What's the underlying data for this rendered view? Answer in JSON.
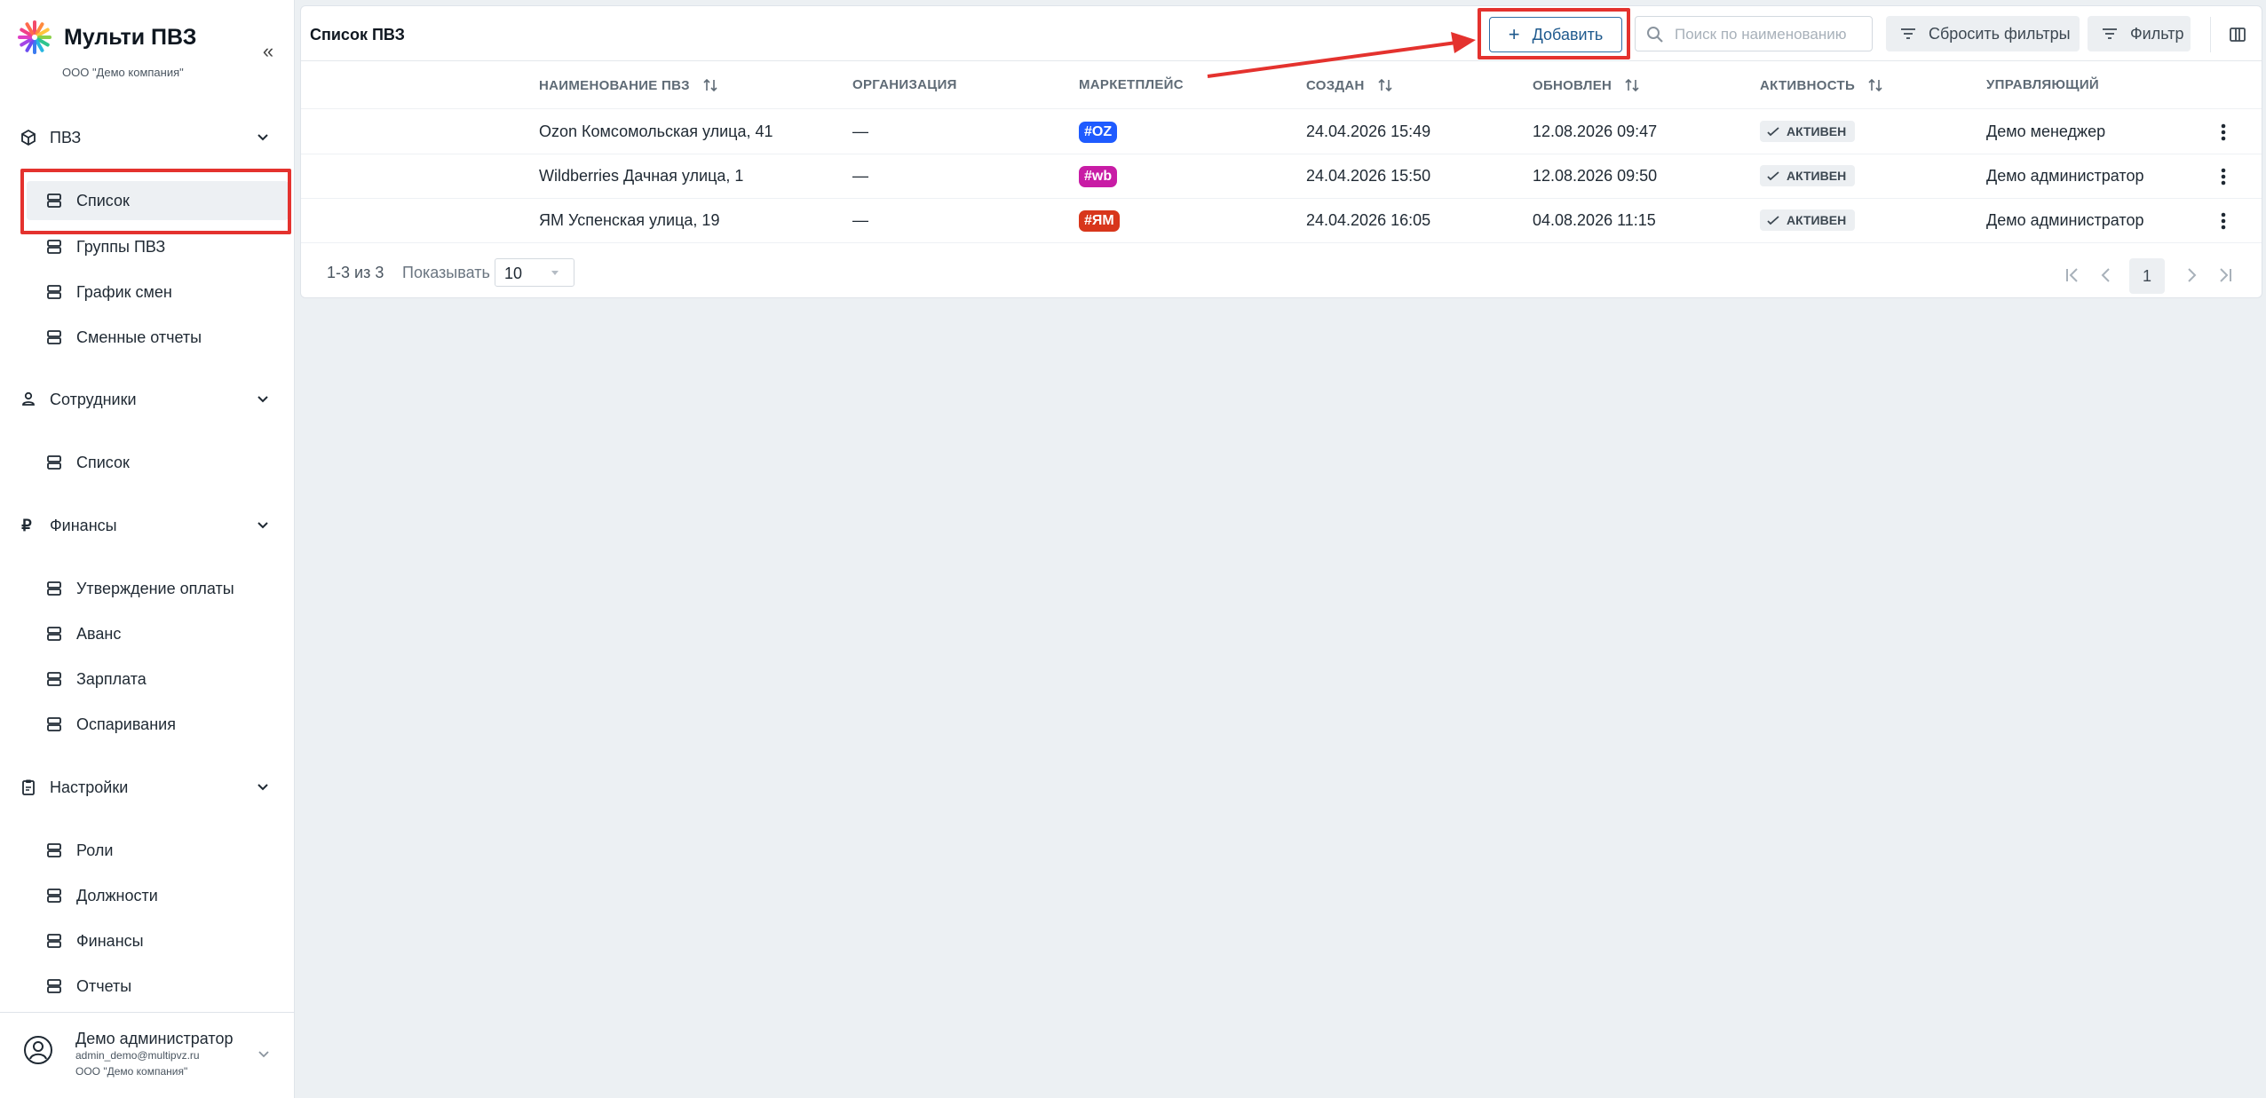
{
  "app": {
    "name": "Мульти ПВЗ",
    "company": "ООО \"Демо компания\"",
    "collapse_glyph": "«"
  },
  "sidebar": {
    "groups": [
      {
        "label": "ПВЗ",
        "icon": "cube-icon",
        "items": [
          "Список",
          "Группы ПВЗ",
          "График смен",
          "Сменные отчеты"
        ]
      },
      {
        "label": "Сотрудники",
        "icon": "person-icon",
        "items": [
          "Список"
        ]
      },
      {
        "label": "Финансы",
        "icon": "ruble-icon",
        "items": [
          "Утверждение оплаты",
          "Аванс",
          "Зарплата",
          "Оспаривания"
        ]
      },
      {
        "label": "Настройки",
        "icon": "clipboard-icon",
        "items": [
          "Роли",
          "Должности",
          "Финансы",
          "Отчеты"
        ]
      }
    ],
    "active_item": "Список",
    "user": {
      "name": "Демо администратор",
      "email": "admin_demo@multipvz.ru",
      "company": "ООО \"Демо компания\""
    }
  },
  "page": {
    "title": "Список ПВЗ",
    "add_label": "Добавить",
    "search_placeholder": "Поиск по наименованию",
    "reset_label": "Сбросить фильтры",
    "filter_label": "Фильтр"
  },
  "table": {
    "columns": [
      "НАИМЕНОВАНИЕ ПВЗ",
      "ОРГАНИЗАЦИЯ",
      "МАРКЕТПЛЕЙС",
      "СОЗДАН",
      "ОБНОВЛЕН",
      "АКТИВНОСТЬ",
      "УПРАВЛЯЮЩИЙ"
    ],
    "rows": [
      {
        "name": "Ozon Комсомольская улица, 41",
        "org": "—",
        "marketplace": "#OZ",
        "mp_color": "#1f5bff",
        "created": "24.04.2026 15:49",
        "updated": "12.08.2026 09:47",
        "status": "АКТИВЕН",
        "manager": "Демо менеджер"
      },
      {
        "name": "Wildberries Дачная улица, 1",
        "org": "—",
        "marketplace": "#wb",
        "mp_color": "#c81ca5",
        "created": "24.04.2026 15:50",
        "updated": "12.08.2026 09:50",
        "status": "АКТИВЕН",
        "manager": "Демо администратор"
      },
      {
        "name": "ЯМ Успенская улица, 19",
        "org": "—",
        "marketplace": "#ЯМ",
        "mp_color": "#d8361b",
        "created": "24.04.2026 16:05",
        "updated": "04.08.2026 11:15",
        "status": "АКТИВЕН",
        "manager": "Демо администратор"
      }
    ]
  },
  "pagination": {
    "range": "1-3 из 3",
    "show_label": "Показывать",
    "page_size": "10",
    "current_page": "1"
  },
  "colors": {
    "accent": "#2f6fa7",
    "highlight": "#e4322e",
    "background": "#ecf0f3"
  }
}
